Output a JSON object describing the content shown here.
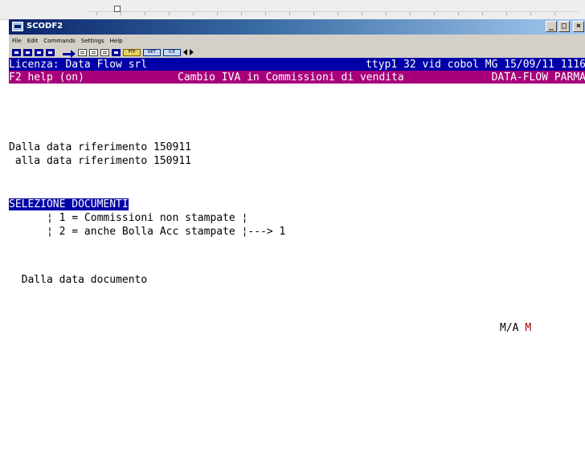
{
  "window": {
    "title": "SCODF2",
    "buttons": {
      "minimize": "_",
      "maximize": "□",
      "close": "×"
    }
  },
  "menu": {
    "items": [
      "File",
      "Edit",
      "Commands",
      "Settings",
      "Help"
    ]
  },
  "toolbar": {
    "icons": [
      "screen-icon",
      "screen-icon",
      "screen-icon",
      "screen-icon",
      "send-arrow-icon",
      "copy-icon",
      "paste-icon",
      "print-icon",
      "computer-icon",
      "ftp-icon",
      "net-icon",
      "ice-icon",
      "prev-icon",
      "next-icon"
    ],
    "ftp_label": "FTP",
    "net_label": "NET",
    "ice_label": "ICE"
  },
  "terminal": {
    "header_left": "Licenza: Data Flow srl",
    "header_right": "ttyp1 32 vid cobol MG 15/09/11 1116",
    "status_left": "F2 help (on)",
    "status_center": "Cambio IVA in Commissioni di vendita",
    "status_right": "DATA-FLOW PARMA",
    "date_from_label": "Dalla data riferimento",
    "date_from_value": "150911",
    "date_to_label": " alla data riferimento",
    "date_to_value": "150911",
    "selection_title": "SELEZIONE DOCUMENTI",
    "option1": "      ¦ 1 = Commissioni non stampate ¦",
    "option2": "      ¦ 2 = anche Bolla Acc stampate ¦---> 1",
    "doc_date_label": "  Dalla data documento",
    "ma_label": "M/A",
    "ma_value": "M"
  },
  "colors": {
    "title_gradient_start": "#0a246a",
    "header_bar": "#0000a8",
    "status_bar": "#a8007a",
    "accent_red": "#a80000"
  }
}
